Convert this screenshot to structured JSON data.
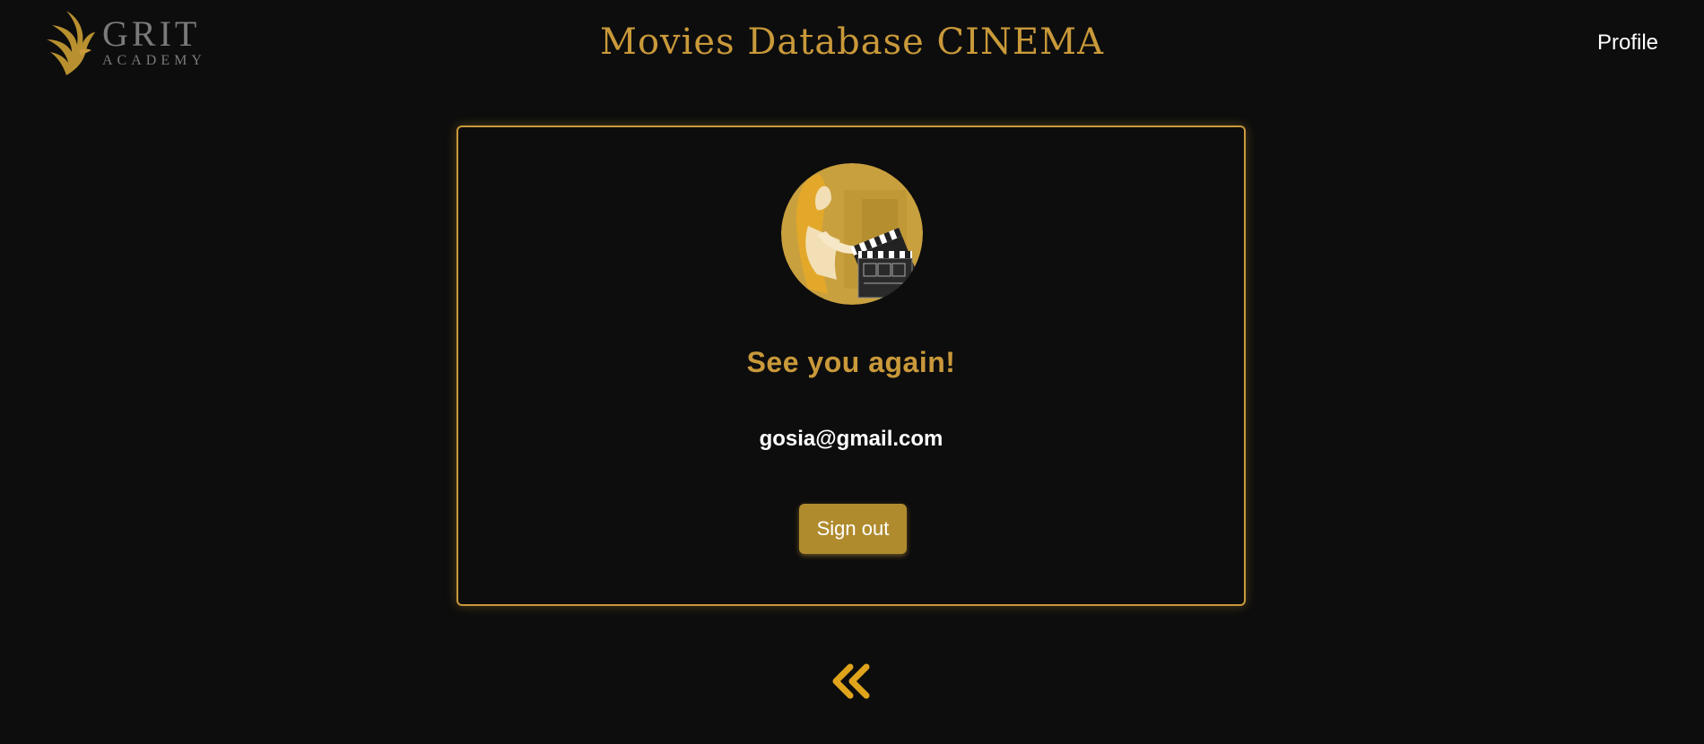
{
  "header": {
    "logo_main": "GRIT",
    "logo_sub": "ACADEMY",
    "title": "Movies Database CINEMA",
    "profile_link": "Profile"
  },
  "card": {
    "greeting": "See you again!",
    "email": "gosia@gmail.com",
    "signout_label": "Sign out"
  },
  "icons": {
    "logo": "phoenix-bird-icon",
    "avatar": "woman-with-clapperboard-illustration",
    "back": "double-chevron-left-icon"
  },
  "colors": {
    "background": "#0d0d0d",
    "accent": "#c9993a",
    "button": "#b08b2e",
    "logo_text": "#7a7a7a"
  }
}
